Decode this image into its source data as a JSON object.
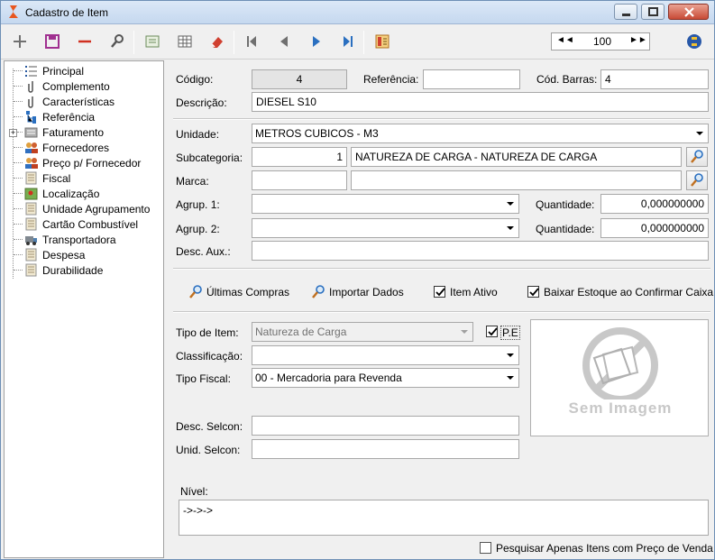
{
  "window": {
    "title": "Cadastro de Item",
    "controls": [
      "minimize-icon",
      "maximize-icon",
      "close-icon"
    ]
  },
  "toolbar": {
    "icons": [
      "plus-icon",
      "save-icon",
      "minus-icon",
      "search-icon",
      "excel-icon",
      "grid-icon",
      "eraser-icon",
      "first-record-icon",
      "prev-record-icon",
      "next-record-icon",
      "last-record-icon",
      "report-icon",
      "help-icon"
    ],
    "pager": {
      "prev_label": "◄◄",
      "value": "100",
      "next_label": "►►"
    }
  },
  "tree": {
    "items": [
      {
        "label": "Principal",
        "icon": "list-icon"
      },
      {
        "label": "Complemento",
        "icon": "paperclip-icon"
      },
      {
        "label": "Características",
        "icon": "paperclip-icon"
      },
      {
        "label": "Referência",
        "icon": "tree-structure-icon"
      },
      {
        "label": "Faturamento",
        "icon": "folder-icon"
      },
      {
        "label": "Fornecedores",
        "icon": "people-icon"
      },
      {
        "label": "Preço p/ Fornecedor",
        "icon": "people-icon"
      },
      {
        "label": "Fiscal",
        "icon": "document-icon"
      },
      {
        "label": "Localização",
        "icon": "map-icon"
      },
      {
        "label": "Unidade Agrupamento",
        "icon": "document-icon"
      },
      {
        "label": "Cartão Combustível",
        "icon": "document-icon"
      },
      {
        "label": "Transportadora",
        "icon": "truck-icon"
      },
      {
        "label": "Despesa",
        "icon": "document-icon"
      },
      {
        "label": "Durabilidade",
        "icon": "document-icon"
      }
    ]
  },
  "form": {
    "codigo_label": "Código:",
    "codigo_value": "4",
    "referencia_label": "Referência:",
    "referencia_value": "",
    "cod_barras_label": "Cód. Barras:",
    "cod_barras_value": "4",
    "descricao_label": "Descrição:",
    "descricao_value": "DIESEL S10",
    "unidade_label": "Unidade:",
    "unidade_value": "METROS CUBICOS - M3",
    "subcategoria_label": "Subcategoria:",
    "subcategoria_code": "1",
    "subcategoria_value": "NATUREZA DE CARGA - NATUREZA DE CARGA",
    "marca_label": "Marca:",
    "marca_code": "",
    "marca_value": "",
    "agrup1_label": "Agrup. 1:",
    "agrup1_value": "",
    "agrup2_label": "Agrup. 2:",
    "agrup2_value": "",
    "quantidade1_label": "Quantidade:",
    "quantidade1_value": "0,000000000",
    "quantidade2_label": "Quantidade:",
    "quantidade2_value": "0,000000000",
    "desc_aux_label": "Desc. Aux.:",
    "desc_aux_value": "",
    "ultimas_compras_label": "Últimas Compras",
    "importar_dados_label": "Importar Dados",
    "item_ativo_label": "Item Ativo",
    "item_ativo_checked": true,
    "baixar_estoque_label": "Baixar Estoque ao Confirmar Caixa",
    "baixar_estoque_checked": true,
    "tipo_item_label": "Tipo de Item:",
    "tipo_item_value": "Natureza de Carga",
    "pe_label": "P.E",
    "pe_checked": true,
    "classificacao_label": "Classificação:",
    "classificacao_value": "",
    "tipo_fiscal_label": "Tipo Fiscal:",
    "tipo_fiscal_value": "00 - Mercadoria para Revenda",
    "image_placeholder_label": "Sem Imagem",
    "desc_selcon_label": "Desc. Selcon:",
    "desc_selcon_value": "",
    "unid_selcon_label": "Unid. Selcon:",
    "unid_selcon_value": "",
    "nivel_label": "Nível:",
    "nivel_value": "->->->",
    "pesquisar_label": "Pesquisar Apenas Itens com Preço de Venda",
    "pesquisar_checked": false
  },
  "colors": {
    "titlebar": "#c5d8ef",
    "window_bg": "#f0f0f0",
    "readonly_bg": "#e4e4e4"
  }
}
